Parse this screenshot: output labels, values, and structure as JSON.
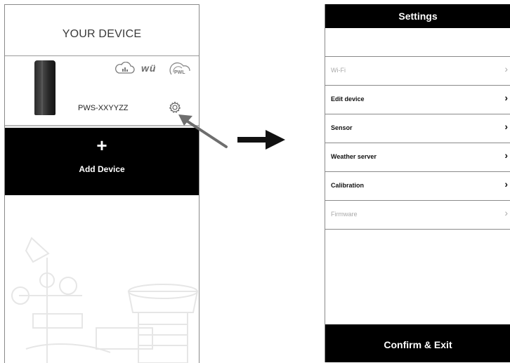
{
  "left_panel": {
    "title": "YOUR DEVICE",
    "device": {
      "name": "PWS-XXYYZZ",
      "service_logos": [
        "cloud-chart-icon",
        "wu-logo",
        "pwl-icon"
      ],
      "wu_text": "wü",
      "pwl_text": "PWL"
    },
    "add_device": {
      "plus": "+",
      "label": "Add Device"
    }
  },
  "settings": {
    "title": "Settings",
    "items": [
      {
        "label": "Wi-Fi",
        "enabled": false
      },
      {
        "label": "Edit device",
        "enabled": true
      },
      {
        "label": "Sensor",
        "enabled": true
      },
      {
        "label": "Weather server",
        "enabled": true
      },
      {
        "label": "Calibration",
        "enabled": true
      },
      {
        "label": "Firmware",
        "enabled": false
      }
    ],
    "chevron": "›",
    "confirm_label": "Confirm & Exit"
  },
  "colors": {
    "accent": "#000000",
    "disabled_text": "#a9a9a9",
    "divider": "#8a8a8a"
  }
}
